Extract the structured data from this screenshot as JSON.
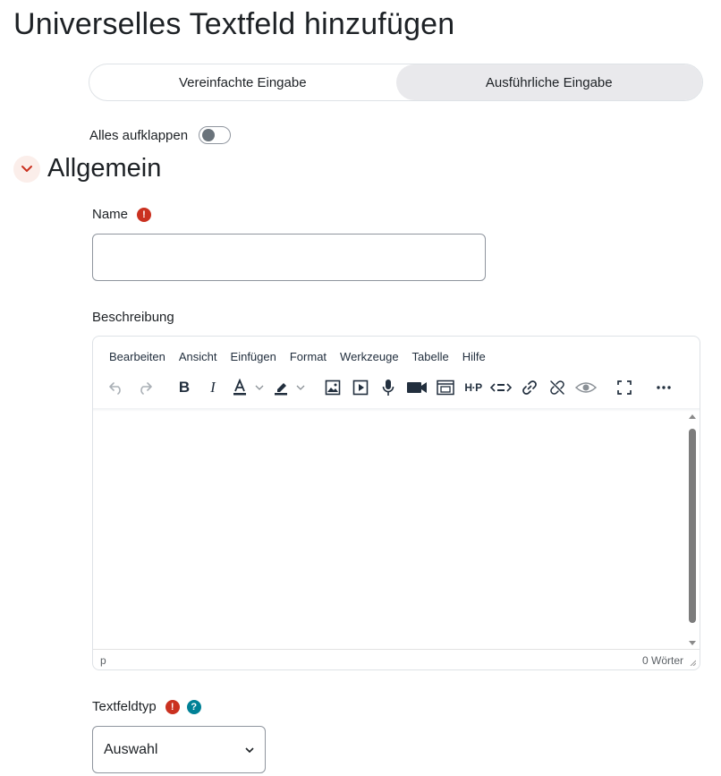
{
  "page": {
    "title": "Universelles Textfeld hinzufügen"
  },
  "mode_switch": {
    "simple": "Vereinfachte Eingabe",
    "advanced": "Ausführliche Eingabe"
  },
  "expand_all": {
    "label": "Alles aufklappen",
    "checked": false
  },
  "section": {
    "title": "Allgemein"
  },
  "name_field": {
    "label": "Name",
    "value": "",
    "required_icon": "!"
  },
  "description": {
    "label": "Beschreibung",
    "menu": [
      "Bearbeiten",
      "Ansicht",
      "Einfügen",
      "Format",
      "Werkzeuge",
      "Tabelle",
      "Hilfe"
    ],
    "toolbar_icons": [
      "undo-icon",
      "redo-icon",
      "bold-icon",
      "italic-icon",
      "text-color-icon",
      "highlight-icon",
      "image-icon",
      "media-icon",
      "microphone-icon",
      "video-camera-icon",
      "embed-icon",
      "h5p-icon",
      "html-icon",
      "link-icon",
      "unlink-icon",
      "preview-icon",
      "fullscreen-icon",
      "more-icon"
    ],
    "bold_glyph": "B",
    "italic_glyph": "I",
    "h5p_glyph": "H·P",
    "status_path": "p",
    "word_count": "0 Wörter"
  },
  "field_type": {
    "label": "Textfeldtyp",
    "required_icon": "!",
    "help_icon": "?",
    "selected": "Auswahl"
  },
  "colors": {
    "accent": "#ca3120",
    "help": "#008196",
    "text": "#1d2125"
  }
}
